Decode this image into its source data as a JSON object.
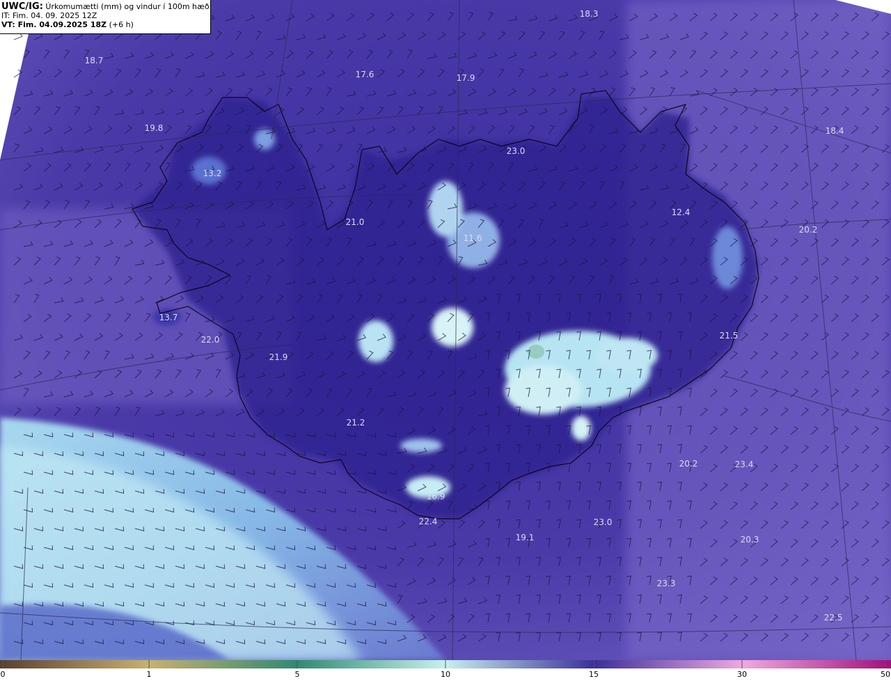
{
  "header": {
    "model": "UWC/IG:",
    "title": " Úrkomumætti (mm) og vindur í 100m hæð",
    "it_line": "IT: Fim. 04. 09. 2025 12Z",
    "vt_label": "VT: Fim. 04.09.2025 18Z",
    "vt_offset": " (+6 h)"
  },
  "colorbar": {
    "ticks": [
      "0",
      "1",
      "5",
      "10",
      "15",
      "30",
      "50"
    ],
    "colors": [
      "#5a4030",
      "#c8b070",
      "#2f8a70",
      "#c8f0f0",
      "#3a2f9a",
      "#f0a8e0",
      "#a0107a"
    ]
  },
  "labels": [
    {
      "text": "18.3"
    },
    {
      "text": "18.7"
    },
    {
      "text": "17.6"
    },
    {
      "text": "17.9"
    },
    {
      "text": "19.8"
    },
    {
      "text": "18.4"
    },
    {
      "text": "13.2"
    },
    {
      "text": "23.0"
    },
    {
      "text": "12.4"
    },
    {
      "text": "21.0"
    },
    {
      "text": "11.6"
    },
    {
      "text": "20.2"
    },
    {
      "text": "13.7"
    },
    {
      "text": "22.0"
    },
    {
      "text": "21.9"
    },
    {
      "text": "21.5"
    },
    {
      "text": "21.2"
    },
    {
      "text": "20.2"
    },
    {
      "text": "23.4"
    },
    {
      "text": "16.9"
    },
    {
      "text": "22.4"
    },
    {
      "text": "23.0"
    },
    {
      "text": "19.1"
    },
    {
      "text": "20.3"
    },
    {
      "text": "23.3"
    },
    {
      "text": "22.5"
    }
  ]
}
